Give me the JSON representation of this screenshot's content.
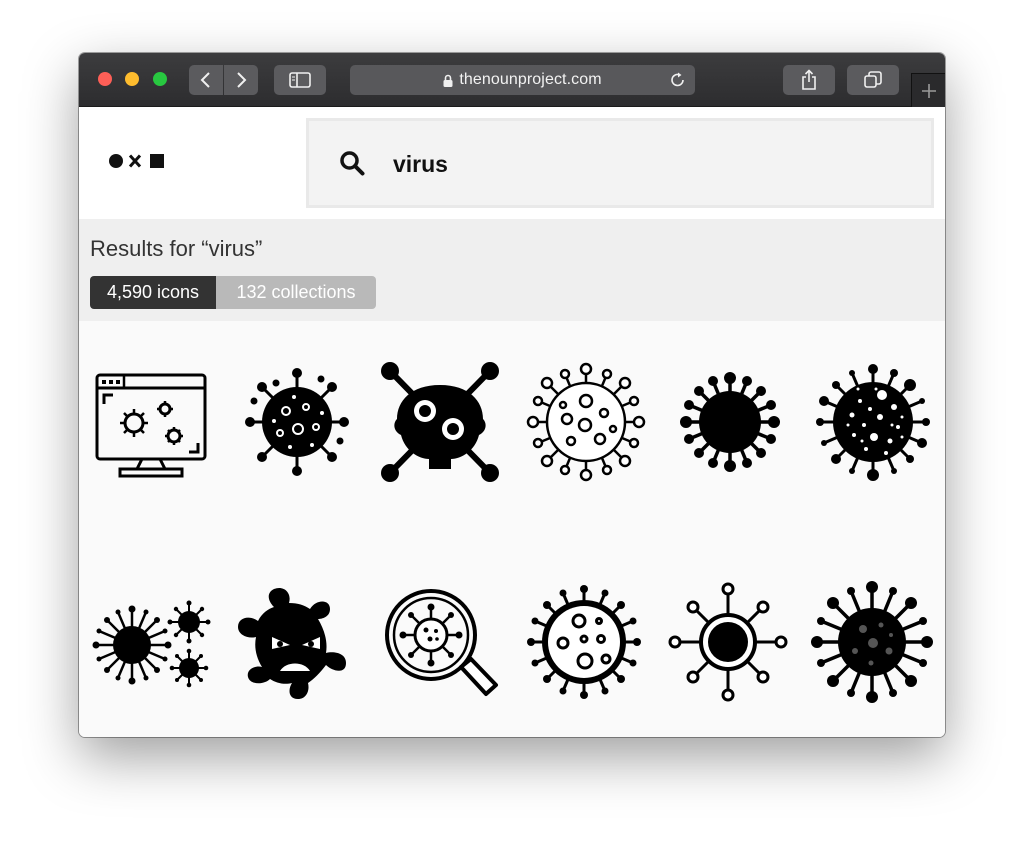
{
  "browser": {
    "url": "thenounproject.com",
    "icons": {
      "back": "chevron-left-icon",
      "forward": "chevron-right-icon",
      "sidebar": "sidebar-icon",
      "lock": "lock-icon",
      "reload": "reload-icon",
      "share": "share-icon",
      "tabs": "tabs-overview-icon",
      "new_tab": "plus-icon"
    }
  },
  "site": {
    "logo": "noun-project-logo",
    "search": {
      "value": "virus",
      "icon": "search-icon"
    }
  },
  "results": {
    "title": "Results for “virus”",
    "icons_count": "4,590 icons",
    "collections_count": "132 collections"
  },
  "grid": {
    "items": [
      "monitor-virus-icon",
      "spotted-virus-icon",
      "skull-virus-icon",
      "outline-virus-icon",
      "solid-virus-icon",
      "dotted-virus-icon",
      "virus-cluster-icon",
      "angry-virus-icon",
      "magnifier-virus-icon",
      "outline-spotted-virus-icon",
      "ring-virus-icon",
      "dark-spiky-virus-icon"
    ]
  },
  "colors": {
    "chrome": "#2d2d2f",
    "chip_active": "#333333",
    "chip_inactive": "#b9b9b9"
  }
}
